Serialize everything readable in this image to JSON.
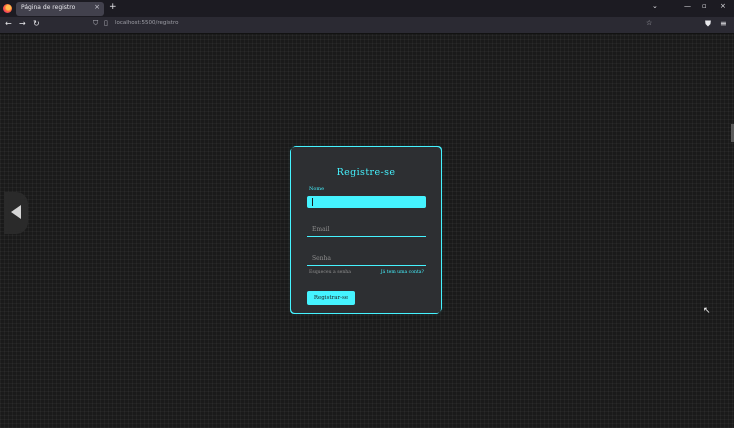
{
  "browser": {
    "tab_title": "Página de registro",
    "tab_close": "×",
    "new_tab": "+",
    "url": "localhost:5500/registro",
    "controls": {
      "list": "⌄",
      "minimize": "—",
      "maximize": "▫",
      "close": "×"
    },
    "nav": {
      "back": "←",
      "forward": "→",
      "reload": "↻"
    },
    "icons": {
      "shield": "⛉",
      "page": "▯",
      "star": "☆",
      "pocket": "⛊",
      "menu": "≡"
    }
  },
  "form": {
    "title": "Registre-se",
    "name_label": "Nome",
    "email_placeholder": "Email",
    "password_placeholder": "Senha",
    "link_left": "Esqueceu a senha",
    "link_right": "Já tem uma conta?",
    "submit_label": "Registrar-se",
    "accent_color": "#45f3ff"
  },
  "page": {
    "prev_arrow": "previous-arrow-icon",
    "cursor": "↖"
  }
}
